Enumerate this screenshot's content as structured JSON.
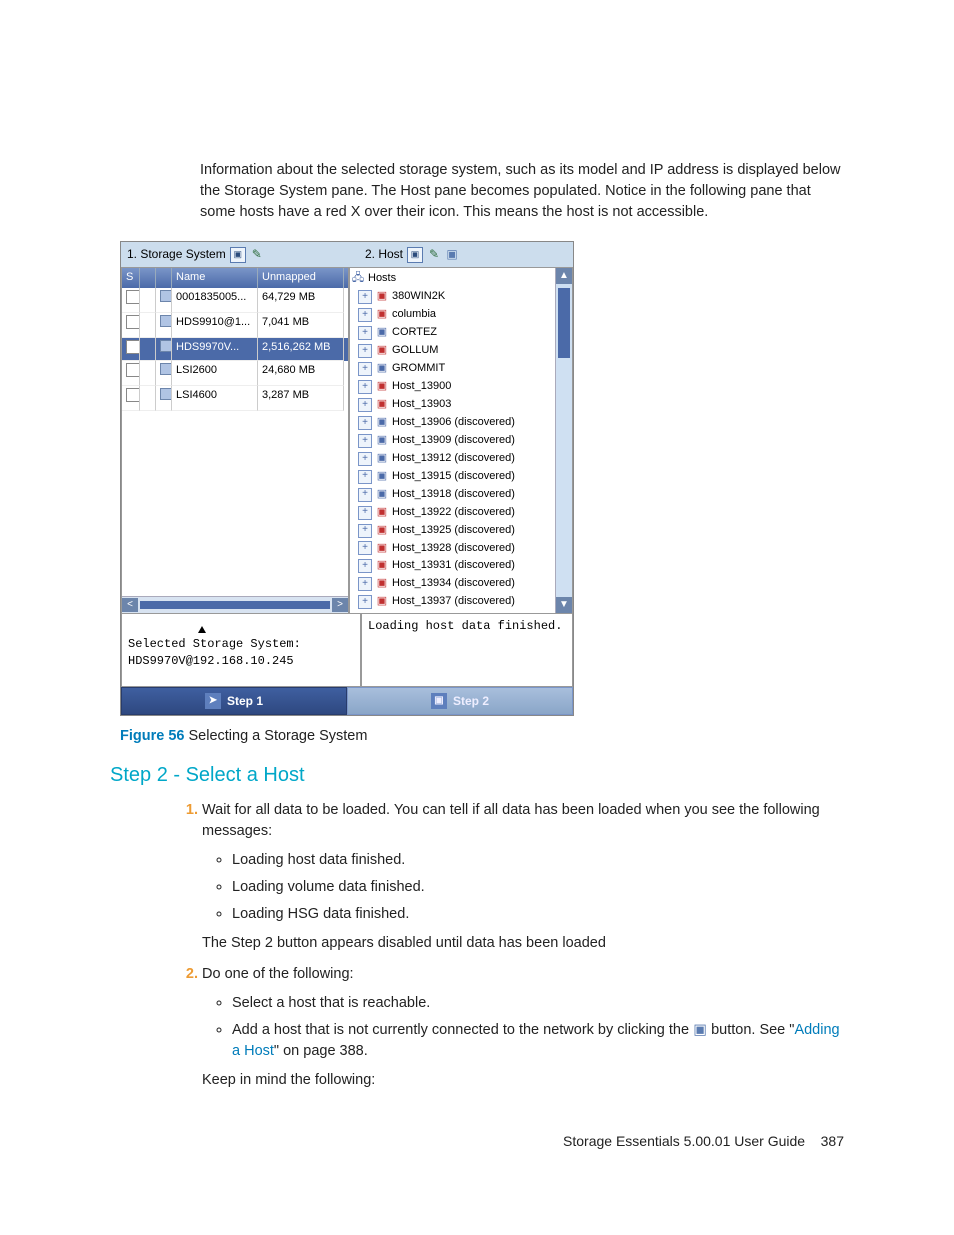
{
  "intro": "Information about the selected storage system, such as its model and IP address is displayed below the Storage System pane. The Host pane becomes populated. Notice in the following pane that some hosts have a red X over their icon. This means the host is not accessible.",
  "shot": {
    "pane1_title": "1. Storage System",
    "pane2_title": "2. Host",
    "storage_headers": {
      "s": "S",
      "name": "Name",
      "unmapped": "Unmapped"
    },
    "storage_rows": [
      {
        "checked": false,
        "name": "0001835005...",
        "unmapped": "64,729 MB"
      },
      {
        "checked": false,
        "name": "HDS9910@1...",
        "unmapped": "7,041 MB"
      },
      {
        "checked": true,
        "name": "HDS9970V...",
        "unmapped": "2,516,262 MB",
        "selected": true
      },
      {
        "checked": false,
        "name": "LSI2600",
        "unmapped": "24,680 MB"
      },
      {
        "checked": false,
        "name": "LSI4600",
        "unmapped": "3,287 MB"
      }
    ],
    "hosts_root": "Hosts",
    "hosts": [
      {
        "label": "380WIN2K",
        "state": "red"
      },
      {
        "label": "columbia",
        "state": "red"
      },
      {
        "label": "CORTEZ",
        "state": "blue"
      },
      {
        "label": "GOLLUM",
        "state": "red"
      },
      {
        "label": "GROMMIT",
        "state": "blue"
      },
      {
        "label": "Host_13900",
        "state": "red"
      },
      {
        "label": "Host_13903",
        "state": "red"
      },
      {
        "label": "Host_13906 (discovered)",
        "state": "blue"
      },
      {
        "label": "Host_13909 (discovered)",
        "state": "blue"
      },
      {
        "label": "Host_13912 (discovered)",
        "state": "blue"
      },
      {
        "label": "Host_13915 (discovered)",
        "state": "blue"
      },
      {
        "label": "Host_13918 (discovered)",
        "state": "blue"
      },
      {
        "label": "Host_13922 (discovered)",
        "state": "red"
      },
      {
        "label": "Host_13925 (discovered)",
        "state": "red"
      },
      {
        "label": "Host_13928 (discovered)",
        "state": "red"
      },
      {
        "label": "Host_13931 (discovered)",
        "state": "red"
      },
      {
        "label": "Host_13934 (discovered)",
        "state": "red"
      },
      {
        "label": "Host_13937 (discovered)",
        "state": "red"
      }
    ],
    "status_left_line1": "Selected Storage System:",
    "status_left_line2": "HDS9970V@192.168.10.245",
    "status_right": "Loading host data finished.",
    "step1": "Step 1",
    "step2": "Step 2"
  },
  "fig": {
    "label": "Figure 56",
    "caption": "Selecting a Storage System"
  },
  "heading2": "Step 2 - Select a Host",
  "step_1_intro": "Wait for all data to be loaded. You can tell if all data has been loaded when you see the following messages:",
  "step_1_bullets": {
    "b1": "Loading host data finished.",
    "b2": "Loading volume data finished.",
    "b3": "Loading HSG data finished."
  },
  "step_1_outro": "The Step 2 button appears disabled until data has been loaded",
  "step_2_intro": "Do one of the following:",
  "step_2_b1": "Select a host that is reachable.",
  "step_2_b2_pre": "Add a host that is not currently connected to the network by clicking the ",
  "step_2_b2_post": " button. See \"",
  "step_2_link": "Adding a Host",
  "step_2_b2_tail": "\" on page 388.",
  "step_2_outro": "Keep in mind the following:",
  "footer": {
    "title": "Storage Essentials 5.00.01 User Guide",
    "page": "387"
  }
}
